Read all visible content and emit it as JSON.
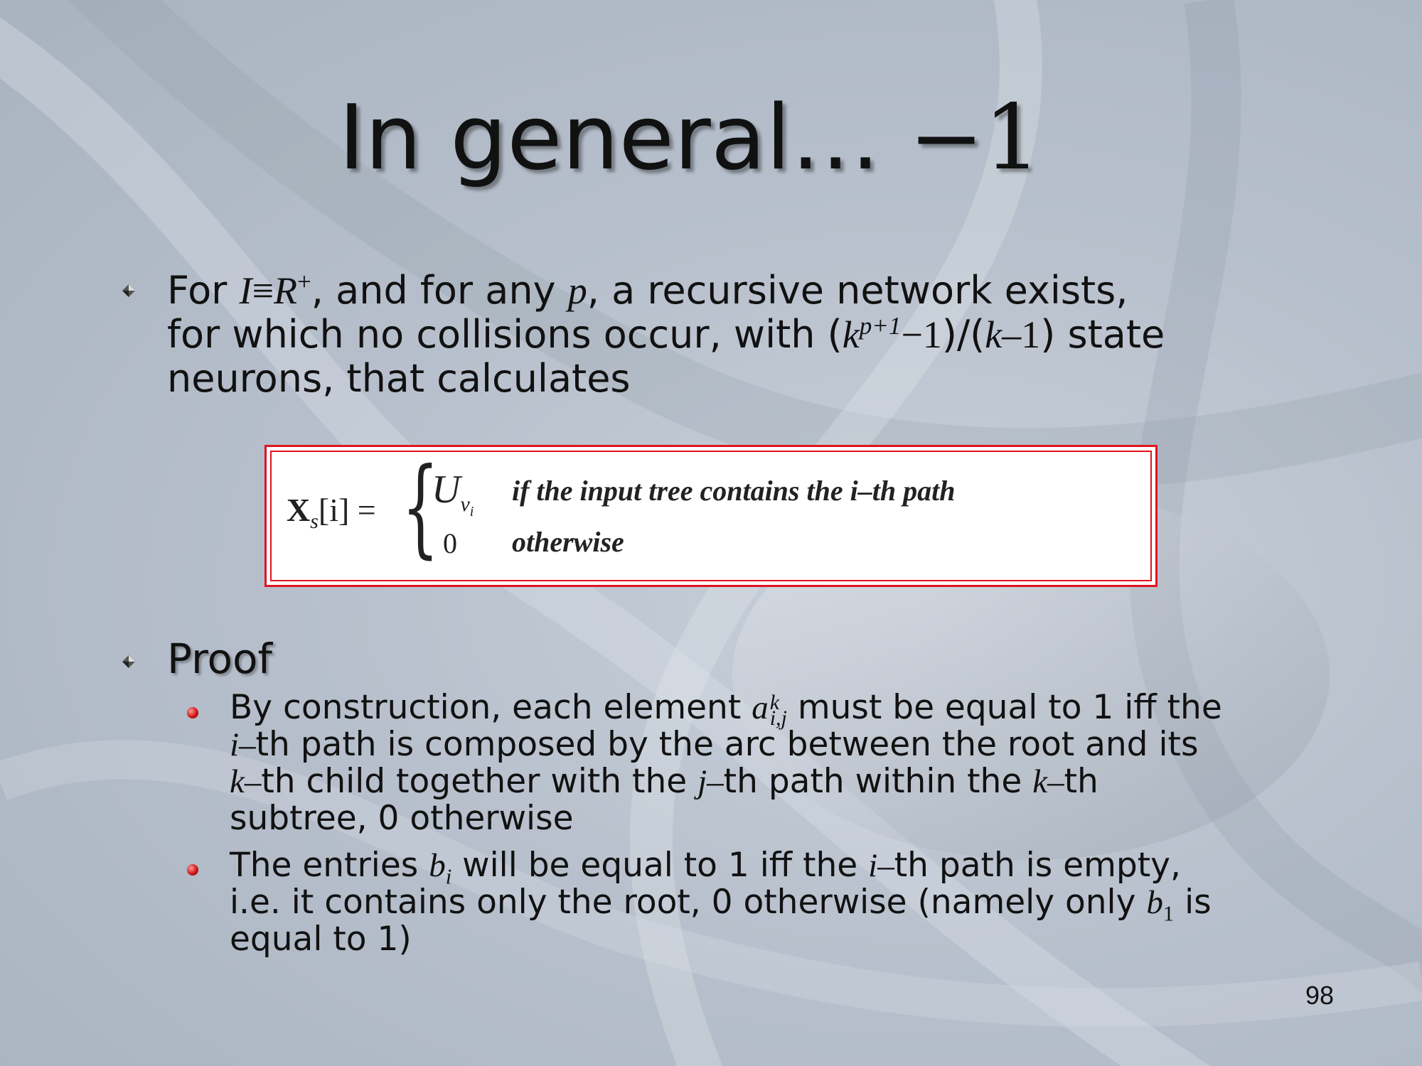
{
  "title": {
    "text": "In general… ",
    "suffix": "−1"
  },
  "bullet1": {
    "line1": [
      "For ",
      "I",
      "≡",
      "R",
      "+",
      ", and for any ",
      "p",
      ", a recursive network exists,"
    ],
    "line2": [
      "for which no collisions occur, with (",
      "k",
      "p+1",
      "−1",
      ")/(",
      "k",
      "–1",
      ") state"
    ],
    "line3": "neurons, that calculates"
  },
  "formula": {
    "lhs": "X",
    "lhs_sub": "s",
    "lhs_index": "[i] =",
    "u": "U",
    "u_sub": "v",
    "u_sub_sub": "i",
    "zero": "0",
    "case1": "if the input tree contains the i–th path",
    "case2": "otherwise"
  },
  "proof": {
    "heading": "Proof",
    "item1": {
      "pre": "By construction, each element ",
      "a": "a",
      "a_sup": "k",
      "a_sub": "i,j",
      "post1": " must be equal to 1 iff the",
      "i": "i",
      "dash1": "–",
      "l2": "th path is composed by the arc between the root and its",
      "k1": "k",
      "dash2": "–",
      "l3a": "th child together with the ",
      "j": "j",
      "dash3": "–",
      "l3b": "th path within the ",
      "k2": "k",
      "dash4": "–",
      "l3c": "th",
      "l4": "subtree, 0 otherwise"
    },
    "item2": {
      "pre": "The entries ",
      "b": "b",
      "b_sub": "i",
      "mid": " will be equal to 1 iff the ",
      "i": "i",
      "dash": "–",
      "post": "th path is empty,",
      "l2a": "i.e. it contains only the root, 0 otherwise (namely only ",
      "b1": "b",
      "b1_sub": "1",
      "l2b": " is",
      "l3": "equal to 1)"
    }
  },
  "page_number": "98",
  "colors": {
    "formula_border": "#e0141e",
    "bullet_dot": "#d01515",
    "background": "#b7c0cc"
  }
}
